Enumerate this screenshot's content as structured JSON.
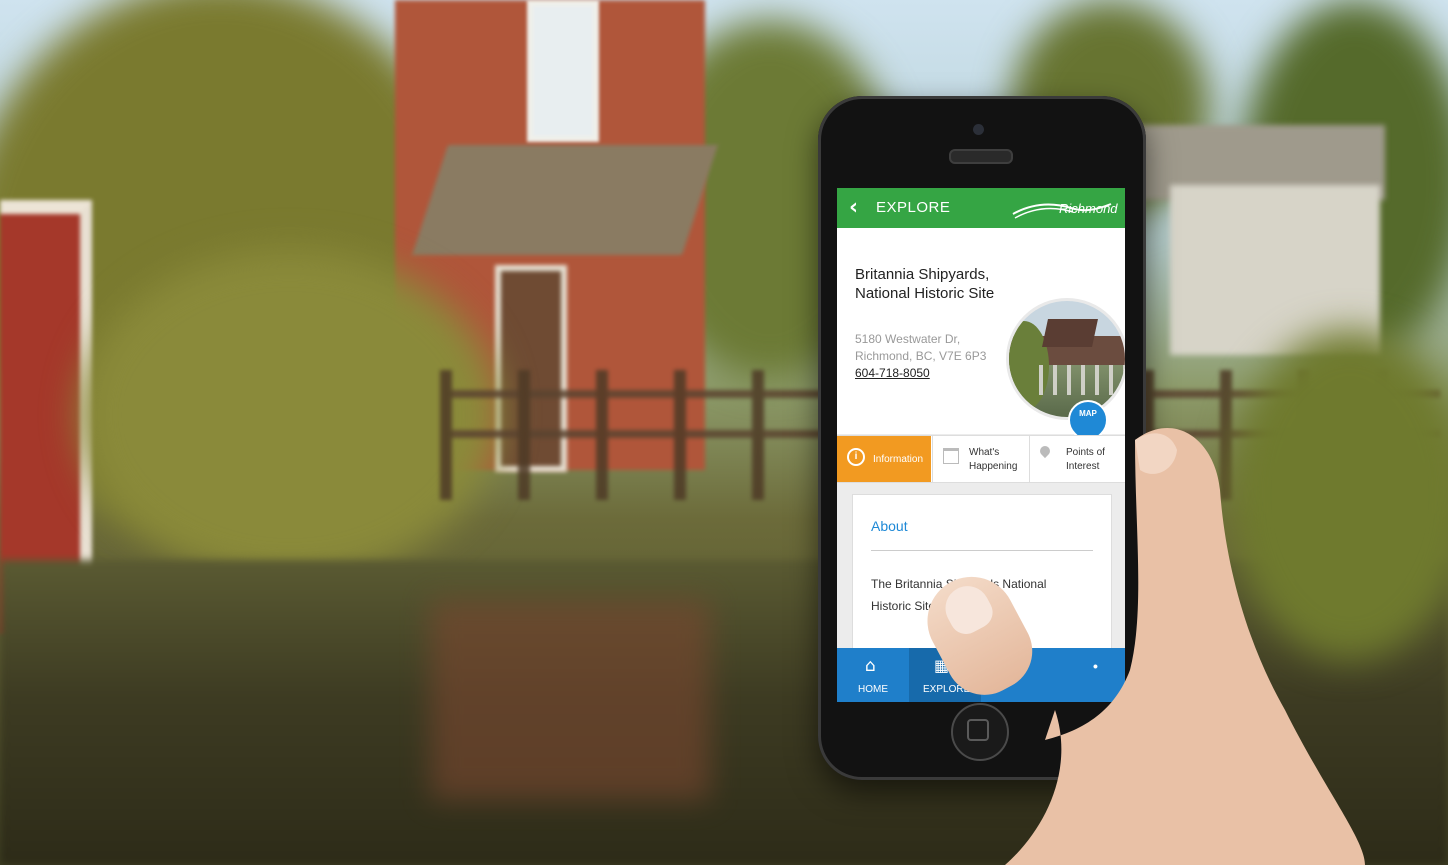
{
  "app": {
    "header": {
      "back_label": "EXPLORE",
      "brand": "Richmond",
      "color": "#35a544"
    },
    "site": {
      "title": "Britannia Shipyards, National Historic Site",
      "address_line1": "5180 Westwater Dr,",
      "address_line2": "Richmond, BC, V7E 6P3",
      "phone": "604-718-8050",
      "map_label": "MAP"
    },
    "tabs": [
      {
        "label": "Information",
        "icon": "info-icon",
        "active": true
      },
      {
        "label": "What's Happening",
        "icon": "calendar-icon",
        "active": false
      },
      {
        "label": "Points of Interest",
        "icon": "map-pin-icon",
        "active": false
      }
    ],
    "about": {
      "title": "About",
      "text": "The Britannia Shipyards National Historic Site represents..."
    },
    "bottom_nav": [
      {
        "label": "HOME",
        "icon": "home-icon"
      },
      {
        "label": "EXPLORE",
        "icon": "map-icon"
      }
    ],
    "accent_colors": {
      "tab_active": "#f29a21",
      "nav": "#1f7fca",
      "link": "#1f89d6"
    }
  }
}
